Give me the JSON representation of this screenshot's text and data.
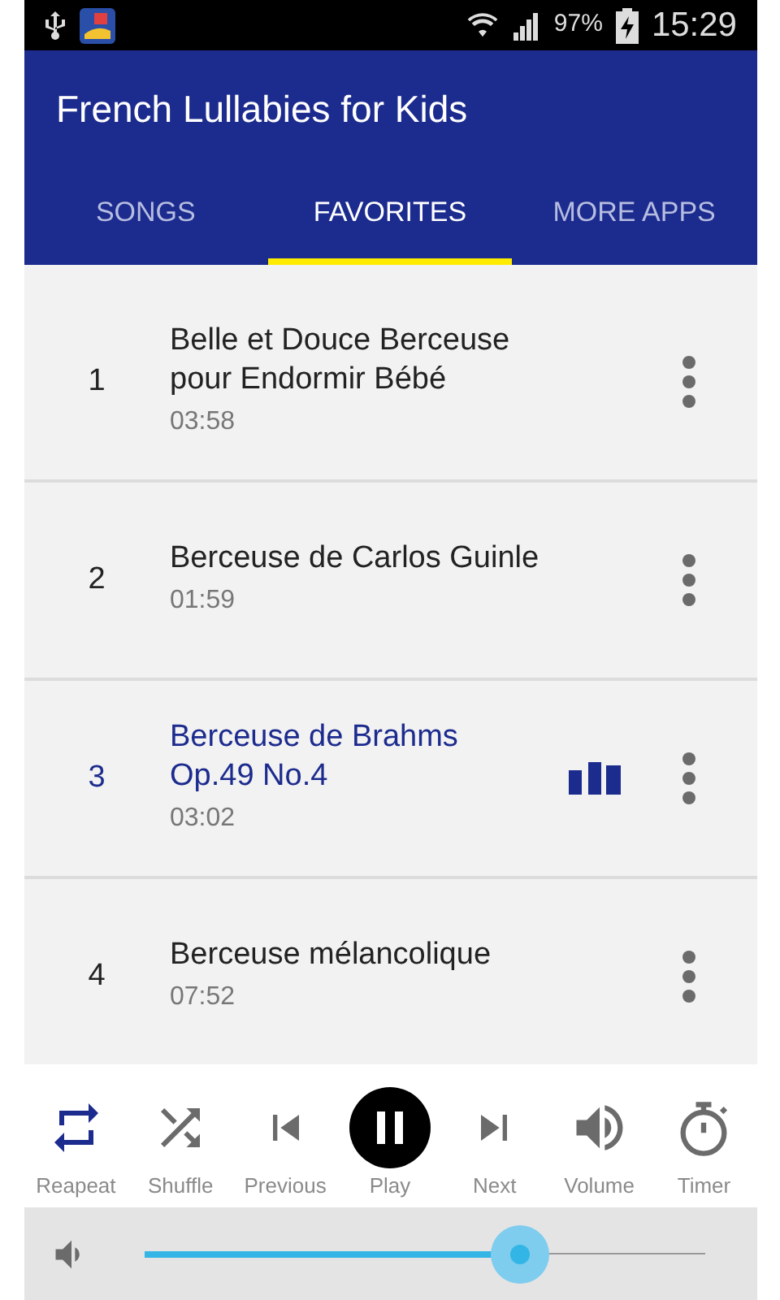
{
  "status_bar": {
    "battery": "97%",
    "time": "15:29"
  },
  "app_bar": {
    "title": "French Lullabies for Kids"
  },
  "tabs": [
    {
      "label": "SONGS",
      "selected": false
    },
    {
      "label": "FAVORITES",
      "selected": true
    },
    {
      "label": "MORE APPS",
      "selected": false
    }
  ],
  "songs": [
    {
      "number": "1",
      "title": "Belle et Douce Berceuse pour Endormir Bébé",
      "duration": "03:58",
      "selected": false
    },
    {
      "number": "2",
      "title": "Berceuse de Carlos Guinle",
      "duration": "01:59",
      "selected": false
    },
    {
      "number": "3",
      "title": "Berceuse de Brahms Op.49 No.4",
      "duration": "03:02",
      "selected": true
    },
    {
      "number": "4",
      "title": "Berceuse mélancolique",
      "duration": "07:52",
      "selected": false
    }
  ],
  "controls": [
    {
      "kind": "repeat",
      "label": "Reapeat",
      "on": true
    },
    {
      "kind": "shuffle",
      "label": "Shuffle",
      "on": false
    },
    {
      "kind": "previous",
      "label": "Previous"
    },
    {
      "kind": "play",
      "label": "Play",
      "playing": true
    },
    {
      "kind": "next",
      "label": "Next"
    },
    {
      "kind": "volume",
      "label": "Volume"
    },
    {
      "kind": "timer",
      "label": "Timer"
    }
  ],
  "volume_slider": {
    "level": 0.67
  }
}
